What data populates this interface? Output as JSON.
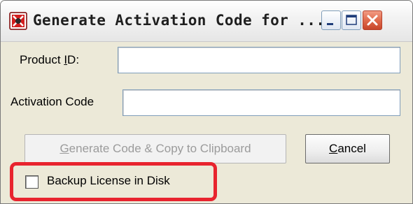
{
  "window": {
    "title": "Generate Activation Code for ...",
    "app_icon": "app-icon",
    "minimize_icon": "minimize-icon",
    "maximize_icon": "maximize-icon",
    "close_icon": "close-icon"
  },
  "form": {
    "product_id_label_prefix": "Product ",
    "product_id_label_accel": "I",
    "product_id_label_suffix": "D:",
    "product_id_value": "",
    "activation_code_label": "Activation Code",
    "activation_code_value": ""
  },
  "buttons": {
    "generate_accel": "G",
    "generate_rest": "enerate Code & Copy to Clipboard",
    "generate_enabled": false,
    "cancel_accel": "C",
    "cancel_rest": "ancel"
  },
  "options": {
    "backup_label": "Backup License in Disk",
    "backup_checked": false
  },
  "annotation": {
    "highlight_color": "#e8242e"
  },
  "colors": {
    "dialog_bg": "#ece9d8",
    "disabled_text": "#9b9b9b"
  }
}
